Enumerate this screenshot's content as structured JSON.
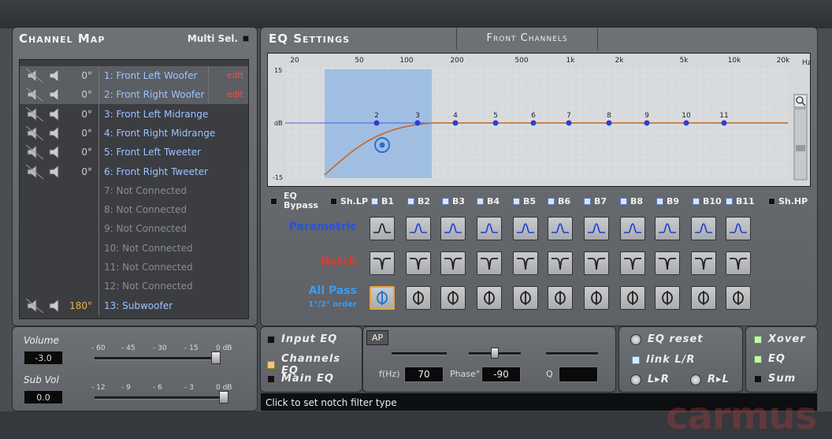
{
  "channel_map": {
    "title": "Channel Map",
    "multi_sel_label": "Multi Sel.",
    "channels": [
      {
        "phase": "0°",
        "name": "1: Front Left Woofer",
        "edit": "edit",
        "selected": true,
        "connected": true
      },
      {
        "phase": "0°",
        "name": "2: Front Right Woofer",
        "edit": "edit",
        "selected": true,
        "connected": true
      },
      {
        "phase": "0°",
        "name": "3: Front Left Midrange",
        "connected": true
      },
      {
        "phase": "0°",
        "name": "4: Front Right Midrange",
        "connected": true
      },
      {
        "phase": "0°",
        "name": "5: Front Left Tweeter",
        "connected": true
      },
      {
        "phase": "0°",
        "name": "6: Front Right Tweeter",
        "connected": true
      },
      {
        "phase": "",
        "name": "7: Not Connected",
        "connected": false
      },
      {
        "phase": "",
        "name": "8: Not Connected",
        "connected": false
      },
      {
        "phase": "",
        "name": "9: Not Connected",
        "connected": false
      },
      {
        "phase": "",
        "name": "10: Not Connected",
        "connected": false
      },
      {
        "phase": "",
        "name": "11: Not Connected",
        "connected": false
      },
      {
        "phase": "",
        "name": "12: Not Connected",
        "connected": false
      },
      {
        "phase": "180°",
        "name": "13: Subwoofer",
        "connected": true
      }
    ]
  },
  "eq_settings": {
    "title": "EQ Settings",
    "tab": "Front Channels",
    "freq_labels": [
      "20",
      "50",
      "100",
      "200",
      "500",
      "1k",
      "2k",
      "5k",
      "10k",
      "20k"
    ],
    "hz": "Hz",
    "db_top": "15",
    "db_mid": "dB",
    "db_bot": "-15",
    "band_points": [
      "2",
      "3",
      "4",
      "5",
      "6",
      "7",
      "8",
      "9",
      "10",
      "11"
    ],
    "eq_bypass": "EQ Bypass",
    "sh_lp": "Sh.LP",
    "bands": [
      "B1",
      "B2",
      "B3",
      "B4",
      "B5",
      "B6",
      "B7",
      "B8",
      "B9",
      "B10",
      "B11"
    ],
    "sh_hp": "Sh.HP",
    "row_parametric": "Parametric",
    "row_notch": "Notch",
    "row_allpass": "All Pass",
    "row_allpass_sub": "1°/2° order"
  },
  "volume": {
    "label": "Volume",
    "value": "-3.0",
    "scale": [
      "- 60",
      "- 45",
      "- 30",
      "- 15",
      "0 dB"
    ],
    "level": 1.0,
    "sub_label": "Sub Vol",
    "sub_value": "0.0",
    "sub_scale": [
      "- 12",
      "- 9",
      "- 6",
      "- 3",
      "0 dB"
    ],
    "sub_level": 1.0
  },
  "eq_source": {
    "input_eq": "Input EQ",
    "channels_eq": "Channels EQ",
    "main_eq": "Main EQ"
  },
  "ap": {
    "tag": "AP",
    "fhz_label": "f(Hz)",
    "fhz_value": "70",
    "phase_label": "Phase°",
    "phase_value": "-90",
    "q_label": "Q",
    "q_value": ""
  },
  "reset": {
    "eq_reset": "EQ reset",
    "link": "link L/R",
    "lr": "L▸R",
    "rl": "R▸L"
  },
  "xover": {
    "xover": "Xover",
    "eq": "EQ",
    "sum": "Sum"
  },
  "status": "Click to set notch filter type",
  "watermark": "carmus"
}
